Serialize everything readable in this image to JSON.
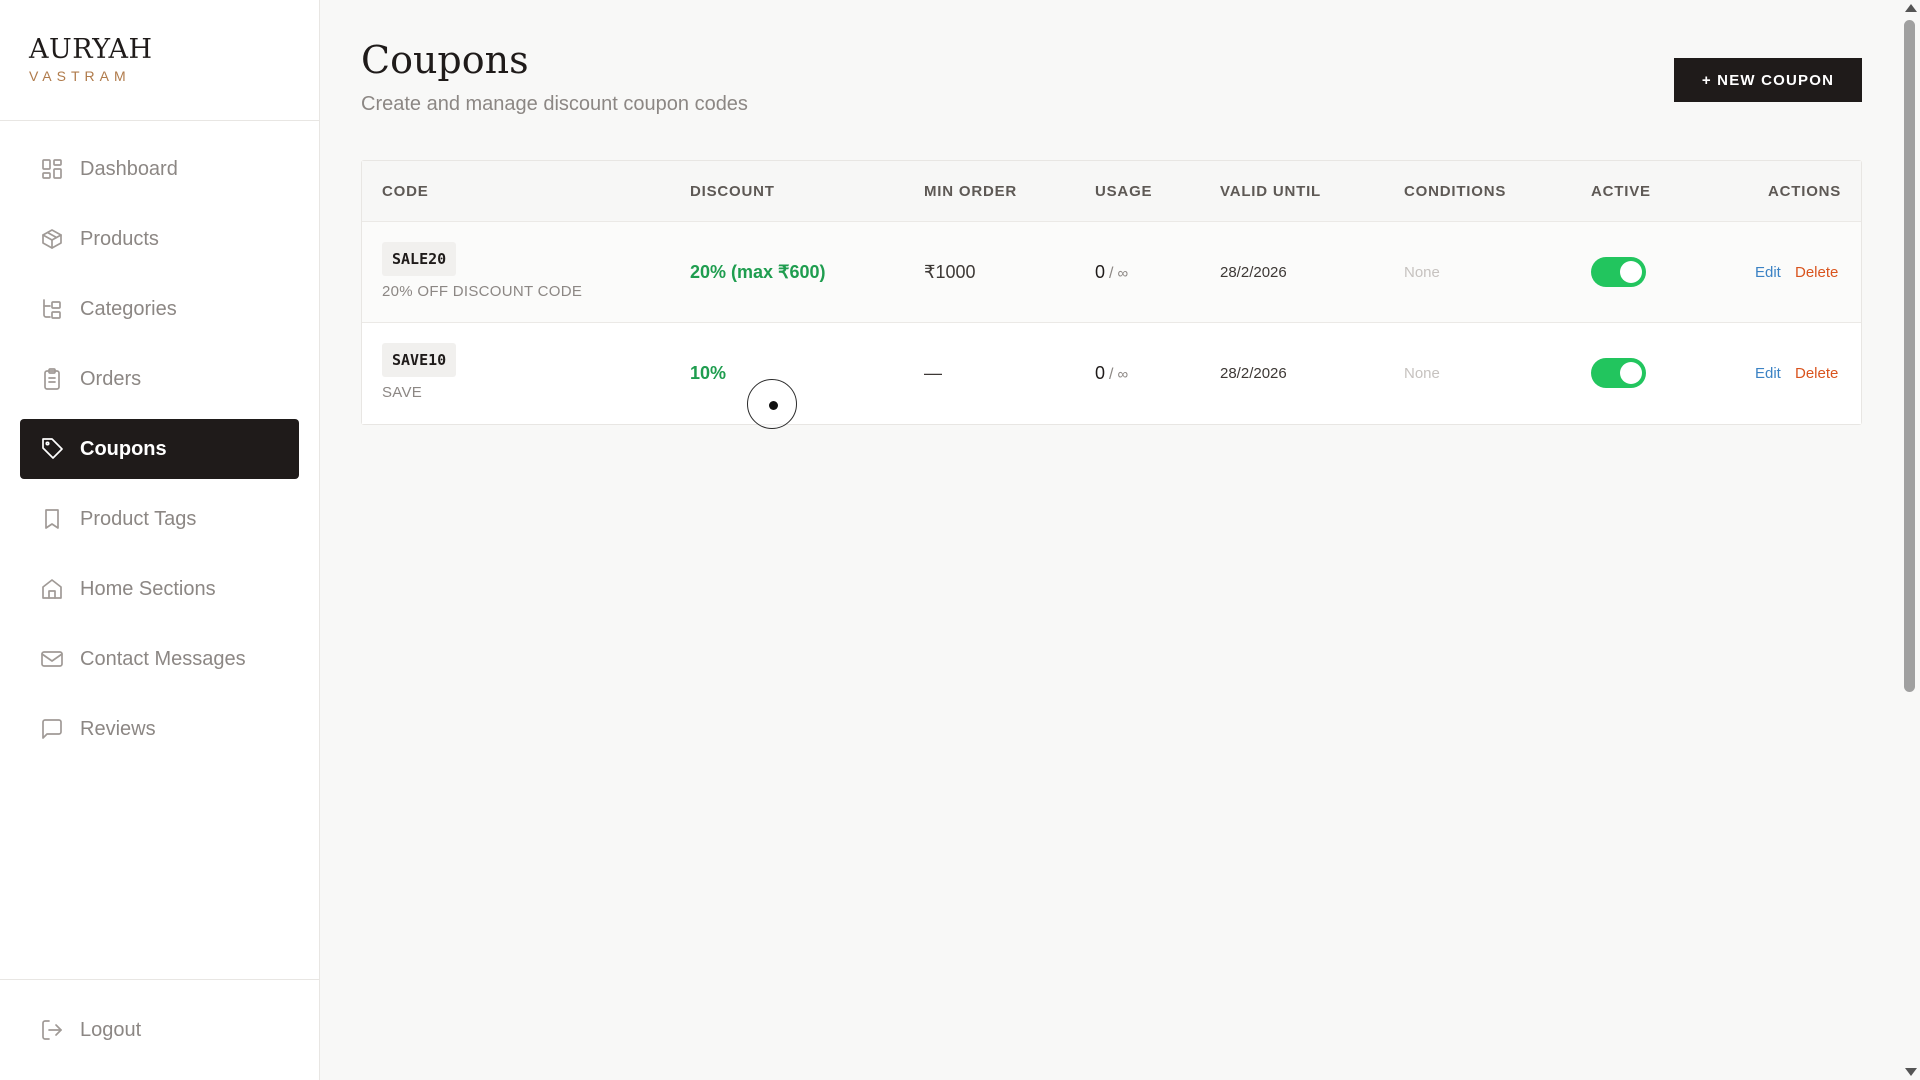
{
  "brand": {
    "name": "AURYAH",
    "sub": "VASTRAM"
  },
  "sidebar": {
    "items": [
      {
        "label": "Dashboard",
        "icon": "dashboard-icon"
      },
      {
        "label": "Products",
        "icon": "package-icon"
      },
      {
        "label": "Categories",
        "icon": "categories-icon"
      },
      {
        "label": "Orders",
        "icon": "clipboard-icon"
      },
      {
        "label": "Coupons",
        "icon": "tag-icon",
        "active": true
      },
      {
        "label": "Product Tags",
        "icon": "bookmark-icon"
      },
      {
        "label": "Home Sections",
        "icon": "home-icon"
      },
      {
        "label": "Contact Messages",
        "icon": "mail-icon"
      },
      {
        "label": "Reviews",
        "icon": "message-square-icon"
      }
    ],
    "logout": "Logout"
  },
  "page": {
    "title": "Coupons",
    "subtitle": "Create and manage discount coupon codes",
    "new_button": "+ NEW COUPON"
  },
  "table": {
    "headers": {
      "code": "CODE",
      "discount": "DISCOUNT",
      "min_order": "MIN ORDER",
      "usage": "USAGE",
      "valid_until": "VALID UNTIL",
      "conditions": "CONDITIONS",
      "active": "ACTIVE",
      "actions": "ACTIONS"
    },
    "rows": [
      {
        "code": "SALE20",
        "description": "20% OFF DISCOUNT CODE",
        "discount": "20% (max ₹600)",
        "min_order": "₹1000",
        "usage_used": "0",
        "usage_sep": "/",
        "usage_limit": "∞",
        "valid_until": "28/2/2026",
        "conditions": "None",
        "active": true,
        "edit": "Edit",
        "delete": "Delete"
      },
      {
        "code": "SAVE10",
        "description": "SAVE",
        "discount": "10%",
        "min_order": "—",
        "usage_used": "0",
        "usage_sep": "/",
        "usage_limit": "∞",
        "valid_until": "28/2/2026",
        "conditions": "None",
        "active": true,
        "edit": "Edit",
        "delete": "Delete"
      }
    ]
  },
  "colors": {
    "accent_dark": "#1f1b1a",
    "brand_gold": "#b07b4b",
    "success_green": "#22c55e",
    "link_blue": "#3b82c4",
    "danger_orange": "#d9541e"
  }
}
